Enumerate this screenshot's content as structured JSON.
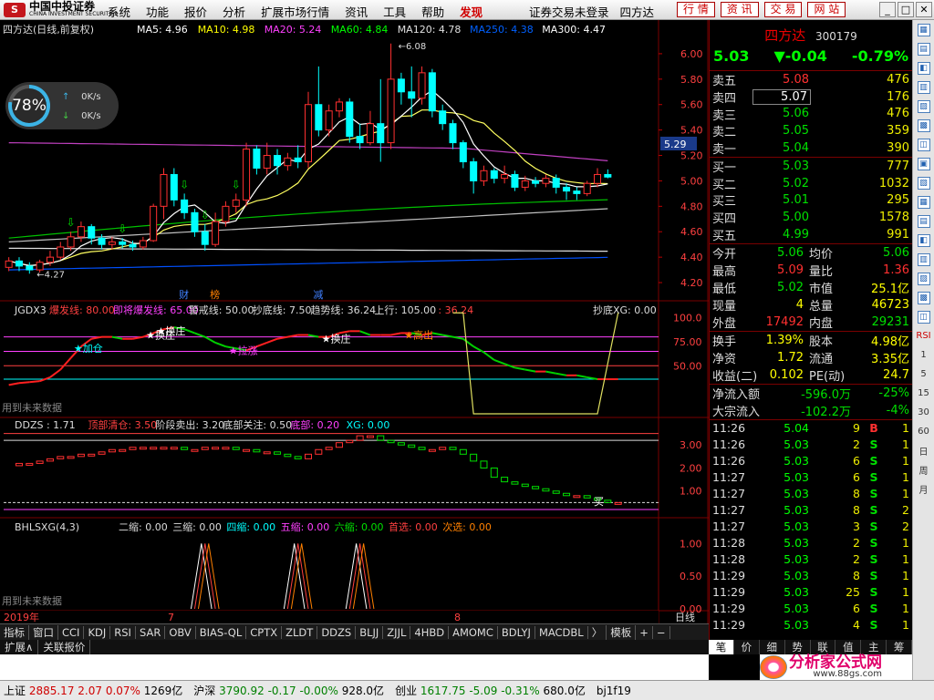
{
  "menubar": {
    "logo_cn": "中国中投证券",
    "logo_en": "CHINA INVESTMENT SECURITIES",
    "items": [
      "系统",
      "功能",
      "报价",
      "分析",
      "扩展市场行情",
      "资讯",
      "工具",
      "帮助",
      "发现"
    ],
    "login_text": "证券交易未登录",
    "stock_name": "四方达",
    "quick_buttons": [
      "行 情",
      "资 讯",
      "交 易",
      "网 站"
    ]
  },
  "main": {
    "title": "四方达(日线,前复权)",
    "ma_labels": [
      "MA5: 4.96",
      "MA10: 4.98",
      "MA20: 5.24",
      "MA60: 4.84",
      "MA120: 4.78",
      "MA250: 4.38",
      "MA300: 4.47"
    ],
    "ma_colors": [
      "#ffffff",
      "#ffff00",
      "#ff40ff",
      "#00ff00",
      "#e0e0e0",
      "#0060ff",
      "#ffffff"
    ],
    "price_ticks": [
      "6.00",
      "5.80",
      "5.60",
      "5.40",
      "5.20",
      "5.00",
      "4.80",
      "4.60",
      "4.40",
      "4.20"
    ],
    "high_label": "6.08",
    "low_label": "4.27",
    "last_price_tag": "5.29",
    "event_markers": [
      "财",
      "榜",
      "减"
    ],
    "date_labels": [
      "2019年",
      "7",
      "8"
    ],
    "period": "日线"
  },
  "net_badge": {
    "percent": 78,
    "up_speed": "0K/s",
    "down_speed": "0K/s"
  },
  "jgdx": {
    "header": [
      "JGDX3",
      "爆发线: 80.00",
      "即将爆发线: 65.00",
      "警戒线: 50.00",
      "抄底线: 7.50",
      "趋势线: 36.24",
      "上行: 105.00",
      ": 36.24",
      "抄底XG: 0.00"
    ],
    "ticks": [
      "100.0",
      "75.00",
      "50.00"
    ],
    "annotations": [
      "加仓",
      "换庄",
      "换庄",
      "拉涨",
      "换庄",
      "高出"
    ],
    "future_note": "用到未来数据"
  },
  "ddzs": {
    "header": [
      "DDZS : 1.71",
      "顶部清仓: 3.50",
      "阶段卖出: 3.20",
      "底部关注: 0.50",
      "底部: 0.20",
      "XG: 0.00"
    ],
    "ticks": [
      "3.00",
      "2.00",
      "1.00"
    ],
    "marker": "买"
  },
  "bhlsxg": {
    "header": [
      "BHLSXG(4,3)",
      "二缩: 0.00",
      "三缩: 0.00",
      "四缩: 0.00",
      "五缩: 0.00",
      "六缩: 0.00",
      "首选: 0.00",
      "次选: 0.00"
    ],
    "ticks": [
      "1.00",
      "0.50",
      "0.00"
    ],
    "future_note": "用到未来数据"
  },
  "chart_data": [
    {
      "type": "candlestick",
      "title": "四方达(日线,前复权)",
      "ylim": [
        4.1,
        6.15
      ],
      "candles": [
        {
          "o": 4.32,
          "c": 4.37,
          "h": 4.4,
          "l": 4.29
        },
        {
          "o": 4.37,
          "c": 4.33,
          "h": 4.4,
          "l": 4.29
        },
        {
          "o": 4.33,
          "c": 4.3,
          "h": 4.36,
          "l": 4.27
        },
        {
          "o": 4.3,
          "c": 4.36,
          "h": 4.38,
          "l": 4.28
        },
        {
          "o": 4.36,
          "c": 4.4,
          "h": 4.45,
          "l": 4.33
        },
        {
          "o": 4.4,
          "c": 4.48,
          "h": 4.52,
          "l": 4.38
        },
        {
          "o": 4.48,
          "c": 4.56,
          "h": 4.6,
          "l": 4.45
        },
        {
          "o": 4.56,
          "c": 4.64,
          "h": 4.68,
          "l": 4.52
        },
        {
          "o": 4.64,
          "c": 4.55,
          "h": 4.66,
          "l": 4.5
        },
        {
          "o": 4.55,
          "c": 4.5,
          "h": 4.58,
          "l": 4.46
        },
        {
          "o": 4.5,
          "c": 4.52,
          "h": 4.56,
          "l": 4.46
        },
        {
          "o": 4.52,
          "c": 4.5,
          "h": 4.55,
          "l": 4.47
        },
        {
          "o": 4.5,
          "c": 4.48,
          "h": 4.53,
          "l": 4.45
        },
        {
          "o": 4.48,
          "c": 4.53,
          "h": 4.56,
          "l": 4.46
        },
        {
          "o": 4.53,
          "c": 4.8,
          "h": 4.82,
          "l": 4.52
        },
        {
          "o": 4.8,
          "c": 5.05,
          "h": 5.1,
          "l": 4.7
        },
        {
          "o": 5.05,
          "c": 4.85,
          "h": 5.1,
          "l": 4.8
        },
        {
          "o": 4.85,
          "c": 4.75,
          "h": 4.9,
          "l": 4.7
        },
        {
          "o": 4.75,
          "c": 4.6,
          "h": 4.78,
          "l": 4.56
        },
        {
          "o": 4.6,
          "c": 4.5,
          "h": 4.66,
          "l": 4.45
        },
        {
          "o": 4.5,
          "c": 4.68,
          "h": 4.75,
          "l": 4.48
        },
        {
          "o": 4.68,
          "c": 4.8,
          "h": 4.84,
          "l": 4.64
        },
        {
          "o": 4.8,
          "c": 4.85,
          "h": 4.9,
          "l": 4.75
        },
        {
          "o": 4.85,
          "c": 5.25,
          "h": 5.3,
          "l": 4.8
        },
        {
          "o": 5.25,
          "c": 5.1,
          "h": 5.28,
          "l": 5.05
        },
        {
          "o": 5.1,
          "c": 5.2,
          "h": 5.3,
          "l": 5.05
        },
        {
          "o": 5.2,
          "c": 5.12,
          "h": 5.25,
          "l": 5.05
        },
        {
          "o": 5.12,
          "c": 5.18,
          "h": 5.22,
          "l": 5.08
        },
        {
          "o": 5.18,
          "c": 5.15,
          "h": 5.28,
          "l": 5.1
        },
        {
          "o": 5.15,
          "c": 5.6,
          "h": 5.7,
          "l": 5.1
        },
        {
          "o": 5.6,
          "c": 5.4,
          "h": 5.9,
          "l": 5.35
        },
        {
          "o": 5.4,
          "c": 5.55,
          "h": 5.6,
          "l": 5.35
        },
        {
          "o": 5.55,
          "c": 5.62,
          "h": 5.65,
          "l": 5.5
        },
        {
          "o": 5.62,
          "c": 5.35,
          "h": 5.65,
          "l": 5.3
        },
        {
          "o": 5.35,
          "c": 5.3,
          "h": 5.45,
          "l": 5.25
        },
        {
          "o": 5.3,
          "c": 5.45,
          "h": 5.55,
          "l": 5.28
        },
        {
          "o": 5.45,
          "c": 5.3,
          "h": 5.8,
          "l": 5.15
        },
        {
          "o": 5.3,
          "c": 5.8,
          "h": 6.08,
          "l": 5.25
        },
        {
          "o": 5.8,
          "c": 5.7,
          "h": 5.85,
          "l": 5.6
        },
        {
          "o": 5.7,
          "c": 5.65,
          "h": 5.9,
          "l": 5.5
        },
        {
          "o": 5.65,
          "c": 5.85,
          "h": 5.9,
          "l": 5.6
        },
        {
          "o": 5.85,
          "c": 5.55,
          "h": 5.88,
          "l": 5.5
        },
        {
          "o": 5.55,
          "c": 5.45,
          "h": 5.6,
          "l": 5.4
        },
        {
          "o": 5.45,
          "c": 5.3,
          "h": 5.48,
          "l": 5.25
        },
        {
          "o": 5.3,
          "c": 5.15,
          "h": 5.32,
          "l": 5.1
        },
        {
          "o": 5.15,
          "c": 5.0,
          "h": 5.18,
          "l": 4.9
        },
        {
          "o": 5.0,
          "c": 5.08,
          "h": 5.12,
          "l": 4.96
        },
        {
          "o": 5.08,
          "c": 5.02,
          "h": 5.1,
          "l": 4.98
        },
        {
          "o": 5.02,
          "c": 5.05,
          "h": 5.12,
          "l": 4.98
        },
        {
          "o": 5.05,
          "c": 4.95,
          "h": 5.08,
          "l": 4.92
        },
        {
          "o": 4.95,
          "c": 5.0,
          "h": 5.04,
          "l": 4.92
        },
        {
          "o": 5.0,
          "c": 4.98,
          "h": 5.03,
          "l": 4.95
        },
        {
          "o": 4.98,
          "c": 5.02,
          "h": 5.05,
          "l": 4.95
        },
        {
          "o": 5.02,
          "c": 4.95,
          "h": 5.05,
          "l": 4.9
        },
        {
          "o": 4.95,
          "c": 4.92,
          "h": 4.98,
          "l": 4.85
        },
        {
          "o": 4.92,
          "c": 4.9,
          "h": 4.95,
          "l": 4.85
        },
        {
          "o": 4.9,
          "c": 4.98,
          "h": 5.0,
          "l": 4.88
        },
        {
          "o": 4.98,
          "c": 5.05,
          "h": 5.1,
          "l": 4.95
        },
        {
          "o": 5.05,
          "c": 5.03,
          "h": 5.09,
          "l": 5.02
        }
      ]
    },
    {
      "type": "line",
      "title": "JGDX3",
      "ylim": [
        0,
        110
      ],
      "series": [
        {
          "name": "趋势线",
          "values": [
            30,
            32,
            33,
            34,
            38,
            46,
            58,
            70,
            78,
            80,
            80,
            78,
            78,
            80,
            84,
            88,
            90,
            88,
            84,
            80,
            74,
            70,
            68,
            66,
            70,
            74,
            78,
            80,
            82,
            82,
            80,
            80,
            84,
            86,
            86,
            82,
            82,
            82,
            84,
            84,
            82,
            84,
            82,
            80,
            78,
            70,
            64,
            56,
            52,
            48,
            46,
            44,
            44,
            42,
            40,
            40,
            38,
            36,
            36,
            36
          ]
        },
        {
          "name": "上行",
          "values": [
            105,
            105,
            105,
            105,
            105,
            105,
            105,
            105,
            105,
            105,
            105,
            105,
            105,
            105,
            105,
            105,
            105,
            105,
            105,
            105,
            105,
            105,
            105,
            105,
            105,
            105,
            105,
            105,
            105,
            105,
            105,
            105,
            105,
            105,
            105,
            105,
            105,
            105,
            105,
            105,
            105,
            105,
            105,
            105,
            105,
            105,
            105,
            105,
            105,
            105,
            105,
            105,
            105,
            105,
            105,
            105,
            105,
            105,
            105,
            105
          ]
        }
      ]
    },
    {
      "type": "bar",
      "title": "DDZS",
      "ylim": [
        0,
        3.8
      ],
      "values": [
        2.1,
        2.2,
        2.2,
        2.3,
        2.4,
        2.5,
        2.5,
        2.6,
        2.6,
        2.7,
        2.8,
        2.8,
        2.9,
        2.9,
        2.9,
        2.9,
        2.9,
        2.8,
        2.8,
        2.9,
        2.9,
        2.9,
        2.8,
        2.8,
        2.7,
        2.7,
        2.6,
        2.5,
        2.4,
        2.6,
        2.8,
        2.9,
        3.1,
        3.2,
        3.4,
        3.4,
        3.2,
        3.1,
        3.0,
        2.9,
        2.8,
        2.8,
        2.9,
        2.8,
        2.6,
        2.3,
        2.0,
        1.6,
        1.4,
        1.3,
        1.2,
        1.1,
        1.0,
        0.9,
        0.8,
        0.8,
        0.7,
        0.6,
        0.5,
        0.5
      ]
    },
    {
      "type": "line",
      "title": "BHLSXG(4,3)",
      "ylim": [
        0,
        1.2
      ],
      "series": [
        {
          "name": "signals",
          "values": [
            0,
            0,
            0,
            0,
            0,
            0,
            0,
            0,
            0,
            0,
            0,
            0,
            0,
            0,
            0,
            0,
            0,
            0,
            0,
            1,
            0,
            0,
            0,
            0,
            0,
            0,
            0,
            0,
            1,
            0,
            0,
            0,
            0,
            0,
            1,
            0,
            0,
            0,
            0,
            0,
            0,
            0,
            0,
            0,
            0,
            0,
            0,
            0,
            0,
            0,
            0,
            0,
            0,
            0,
            0,
            0,
            0,
            0,
            0,
            0
          ]
        }
      ]
    }
  ],
  "quote": {
    "name": "四方达",
    "code": "300179",
    "price": "5.03",
    "change": "▼-0.04",
    "change_pct": "-0.79%",
    "asks": [
      {
        "label": "卖五",
        "price": "5.08",
        "vol": "476",
        "color": "#ff3030"
      },
      {
        "label": "卖四",
        "price": "5.07",
        "vol": "176",
        "color": "#ffffff"
      },
      {
        "label": "卖三",
        "price": "5.06",
        "vol": "476",
        "color": "#00e000"
      },
      {
        "label": "卖二",
        "price": "5.05",
        "vol": "359",
        "color": "#00e000"
      },
      {
        "label": "卖一",
        "price": "5.04",
        "vol": "390",
        "color": "#00e000"
      }
    ],
    "bids": [
      {
        "label": "买一",
        "price": "5.03",
        "vol": "777",
        "color": "#00e000"
      },
      {
        "label": "买二",
        "price": "5.02",
        "vol": "1032",
        "color": "#00e000"
      },
      {
        "label": "买三",
        "price": "5.01",
        "vol": "295",
        "color": "#00e000"
      },
      {
        "label": "买四",
        "price": "5.00",
        "vol": "1578",
        "color": "#00e000"
      },
      {
        "label": "买五",
        "price": "4.99",
        "vol": "991",
        "color": "#00e000"
      }
    ],
    "stats": [
      {
        "l1": "今开",
        "v1": "5.06",
        "c1": "#00e000",
        "l2": "均价",
        "v2": "5.06",
        "c2": "#00e000"
      },
      {
        "l1": "最高",
        "v1": "5.09",
        "c1": "#ff3030",
        "l2": "量比",
        "v2": "1.36",
        "c2": "#ff3030"
      },
      {
        "l1": "最低",
        "v1": "5.02",
        "c1": "#00e000",
        "l2": "市值",
        "v2": "25.1亿",
        "c2": "#ffff00"
      },
      {
        "l1": "现量",
        "v1": "4",
        "c1": "#ffff00",
        "l2": "总量",
        "v2": "46723",
        "c2": "#ffff00"
      },
      {
        "l1": "外盘",
        "v1": "17492",
        "c1": "#ff3030",
        "l2": "内盘",
        "v2": "29231",
        "c2": "#00e000"
      }
    ],
    "stats2": [
      {
        "l1": "换手",
        "v1": "1.39%",
        "c1": "#ffff00",
        "l2": "股本",
        "v2": "4.98亿",
        "c2": "#ffff00"
      },
      {
        "l1": "净资",
        "v1": "1.72",
        "c1": "#ffff00",
        "l2": "流通",
        "v2": "3.35亿",
        "c2": "#ffff00"
      },
      {
        "l1": "收益(二)",
        "v1": "0.102",
        "c1": "#ffff00",
        "l2": "PE(动)",
        "v2": "24.7",
        "c2": "#ffff00"
      }
    ],
    "flows": [
      {
        "label": "净流入额",
        "value": "-596.0万",
        "pct": "-25%"
      },
      {
        "label": "大宗流入",
        "value": "-102.2万",
        "pct": "-4%"
      }
    ],
    "ticks": [
      {
        "t": "11:26",
        "p": "5.04",
        "v": "9",
        "bs": "B",
        "n": "1"
      },
      {
        "t": "11:26",
        "p": "5.03",
        "v": "2",
        "bs": "S",
        "n": "1"
      },
      {
        "t": "11:26",
        "p": "5.03",
        "v": "6",
        "bs": "S",
        "n": "1"
      },
      {
        "t": "11:27",
        "p": "5.03",
        "v": "6",
        "bs": "S",
        "n": "1"
      },
      {
        "t": "11:27",
        "p": "5.03",
        "v": "8",
        "bs": "S",
        "n": "1"
      },
      {
        "t": "11:27",
        "p": "5.03",
        "v": "8",
        "bs": "S",
        "n": "2"
      },
      {
        "t": "11:27",
        "p": "5.03",
        "v": "3",
        "bs": "S",
        "n": "2"
      },
      {
        "t": "11:28",
        "p": "5.03",
        "v": "2",
        "bs": "S",
        "n": "1"
      },
      {
        "t": "11:28",
        "p": "5.03",
        "v": "2",
        "bs": "S",
        "n": "1"
      },
      {
        "t": "11:29",
        "p": "5.03",
        "v": "8",
        "bs": "S",
        "n": "1"
      },
      {
        "t": "11:29",
        "p": "5.03",
        "v": "25",
        "bs": "S",
        "n": "1"
      },
      {
        "t": "11:29",
        "p": "5.03",
        "v": "6",
        "bs": "S",
        "n": "1"
      },
      {
        "t": "11:29",
        "p": "5.03",
        "v": "4",
        "bs": "S",
        "n": "1"
      }
    ],
    "tabs": [
      "笔",
      "价",
      "细",
      "势",
      "联",
      "值",
      "主",
      "筹"
    ]
  },
  "indicator_tabs": [
    "指标",
    "窗口",
    "CCI",
    "KDJ",
    "RSI",
    "SAR",
    "OBV",
    "BIAS-QL",
    "CPTX",
    "ZLDT",
    "DDZS",
    "BLJJ",
    "ZJJL",
    "4HBD",
    "AMOMC",
    "BDLYJ",
    "MACDBL",
    "〉",
    "模板",
    "+",
    "−"
  ],
  "bottom_tabs": [
    "扩展∧",
    "关联报价"
  ],
  "statusbar": [
    {
      "name": "上证",
      "price": "2885.17",
      "chg": "2.07",
      "pct": "0.07%",
      "vol": "1269亿",
      "dir": "up"
    },
    {
      "name": "沪深",
      "price": "3790.92",
      "chg": "-0.17",
      "pct": "-0.00%",
      "vol": "928.0亿",
      "dir": "dn"
    },
    {
      "name": "创业",
      "price": "1617.75",
      "chg": "-5.09",
      "pct": "-0.31%",
      "vol": "680.0亿",
      "dir": "dn"
    }
  ],
  "status_extra": "bj1f19",
  "watermark": {
    "title": "分析家公式网",
    "url": "www.88gs.com"
  },
  "sidebar_items": [
    "RSI",
    "1",
    "5",
    "15",
    "30",
    "60",
    "日",
    "周",
    "月"
  ]
}
